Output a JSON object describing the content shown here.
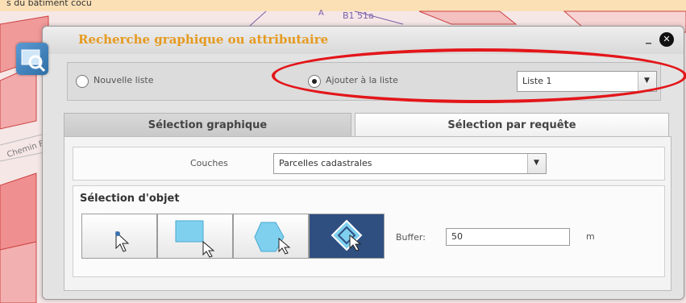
{
  "map": {
    "top_text": "s du bâtiment cocu",
    "parcel_label": "B1 51a",
    "parcel_small": "A",
    "road_label": "Chemin F"
  },
  "dialog": {
    "title": "Recherche graphique ou attributaire",
    "minimize": "_",
    "close": "✕"
  },
  "list_options": {
    "new_list_label": "Nouvelle liste",
    "add_to_list_label": "Ajouter à la liste",
    "selected_option": "add_to_list",
    "list_select_value": "Liste 1"
  },
  "tabs": {
    "graphique": "Sélection graphique",
    "requete": "Sélection par requête",
    "active": "graphique"
  },
  "couches": {
    "label": "Couches",
    "value": "Parcelles cadastrales"
  },
  "selection": {
    "title": "Sélection d'objet",
    "tools": [
      {
        "name": "point-select-tool",
        "icon": "pointer-click-icon",
        "active": false
      },
      {
        "name": "rectangle-select-tool",
        "icon": "rectangle-select-icon",
        "active": false
      },
      {
        "name": "polygon-select-tool",
        "icon": "hexagon-select-icon",
        "active": false
      },
      {
        "name": "object-select-tool",
        "icon": "diamond-select-icon",
        "active": true
      }
    ],
    "buffer_label": "Buffer:",
    "buffer_value": "50",
    "buffer_unit": "m"
  },
  "colors": {
    "title": "#e69a1f",
    "annotation": "#e3161a",
    "active_tool": "#2f4f80"
  }
}
